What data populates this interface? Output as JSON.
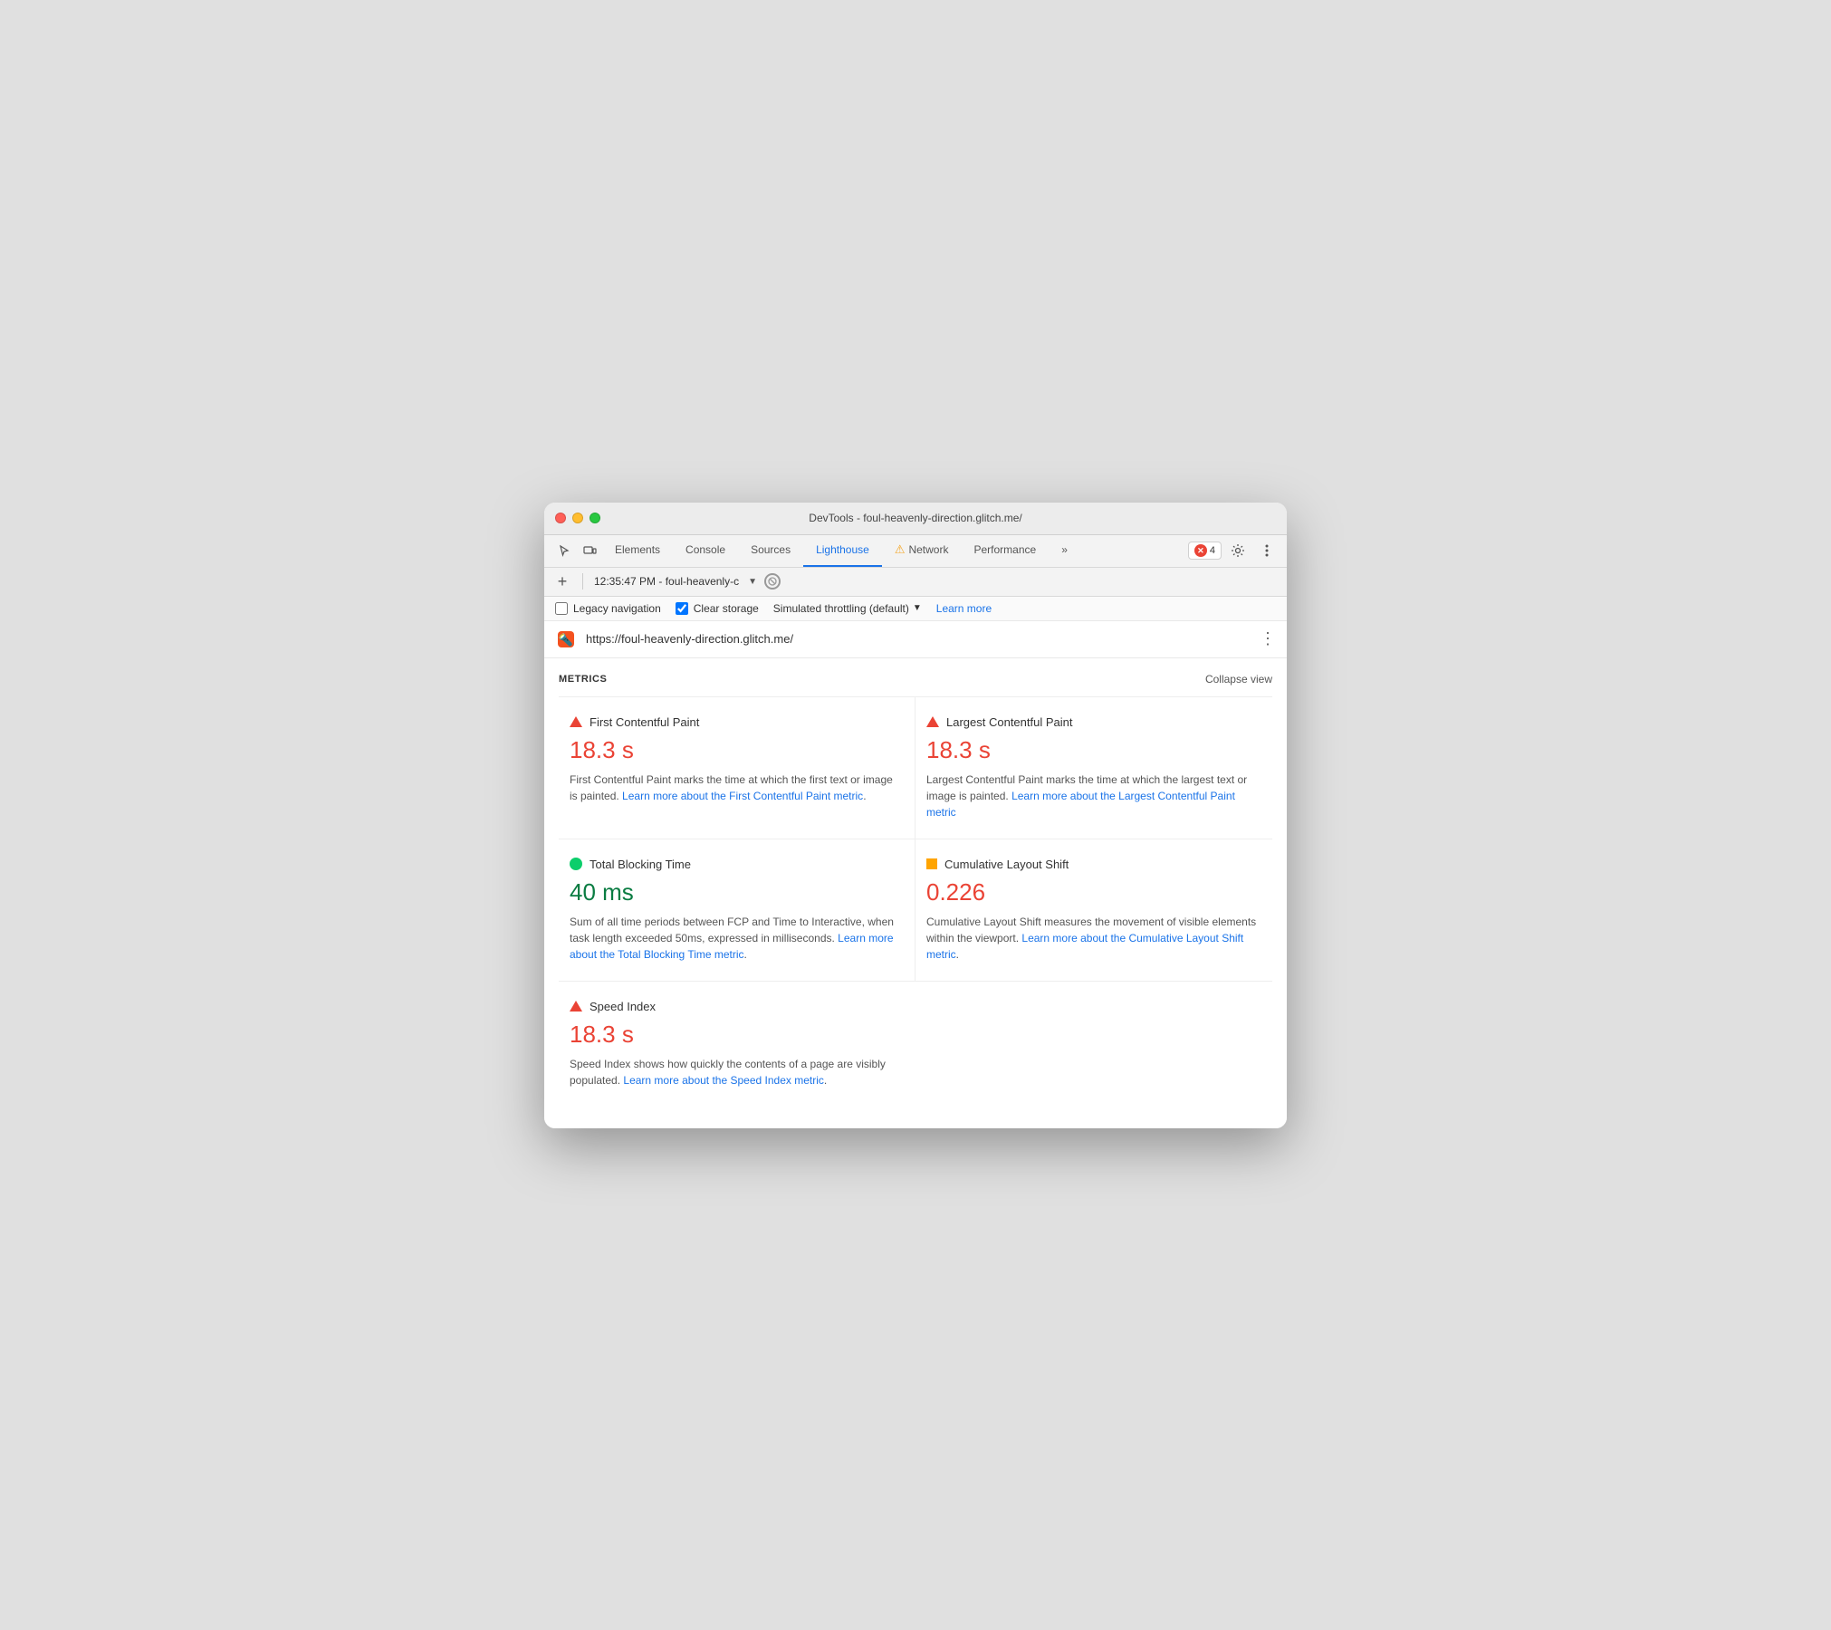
{
  "window": {
    "title": "DevTools - foul-heavenly-direction.glitch.me/"
  },
  "tabs": [
    {
      "label": "Elements",
      "active": false
    },
    {
      "label": "Console",
      "active": false
    },
    {
      "label": "Sources",
      "active": false
    },
    {
      "label": "Lighthouse",
      "active": true
    },
    {
      "label": "Network",
      "active": false,
      "warning": true
    },
    {
      "label": "Performance",
      "active": false
    }
  ],
  "toolbar": {
    "more_label": "»",
    "error_count": "4",
    "timestamp": "12:35:47 PM - foul-heavenly-c",
    "plus_label": "+",
    "collapse_label": "Collapse view",
    "metrics_label": "METRICS"
  },
  "options": {
    "legacy_navigation_label": "Legacy navigation",
    "legacy_navigation_checked": false,
    "clear_storage_label": "Clear storage",
    "clear_storage_checked": true,
    "throttling_label": "Simulated throttling (default)",
    "learn_more_label": "Learn more"
  },
  "url_bar": {
    "url": "https://foul-heavenly-direction.glitch.me/"
  },
  "metrics": [
    {
      "id": "fcp",
      "name": "First Contentful Paint",
      "value": "18.3 s",
      "value_type": "red",
      "icon_type": "triangle-red",
      "description": "First Contentful Paint marks the time at which the first text or image is painted.",
      "link_text": "Learn more about the First Contentful Paint metric",
      "link_href": "#"
    },
    {
      "id": "lcp",
      "name": "Largest Contentful Paint",
      "value": "18.3 s",
      "value_type": "red",
      "icon_type": "triangle-red",
      "description": "Largest Contentful Paint marks the time at which the largest text or image is painted.",
      "link_text": "Learn more about the Largest Contentful Paint metric",
      "link_href": "#"
    },
    {
      "id": "tbt",
      "name": "Total Blocking Time",
      "value": "40 ms",
      "value_type": "green",
      "icon_type": "circle-green",
      "description": "Sum of all time periods between FCP and Time to Interactive, when task length exceeded 50ms, expressed in milliseconds.",
      "link_text": "Learn more about the Total Blocking Time metric",
      "link_href": "#"
    },
    {
      "id": "cls",
      "name": "Cumulative Layout Shift",
      "value": "0.226",
      "value_type": "orange",
      "icon_type": "square-orange",
      "description": "Cumulative Layout Shift measures the movement of visible elements within the viewport.",
      "link_text": "Learn more about the Cumulative Layout Shift metric",
      "link_href": "#"
    },
    {
      "id": "si",
      "name": "Speed Index",
      "value": "18.3 s",
      "value_type": "red",
      "icon_type": "triangle-red",
      "description": "Speed Index shows how quickly the contents of a page are visibly populated.",
      "link_text": "Learn more about the Speed Index metric",
      "link_href": "#"
    }
  ]
}
